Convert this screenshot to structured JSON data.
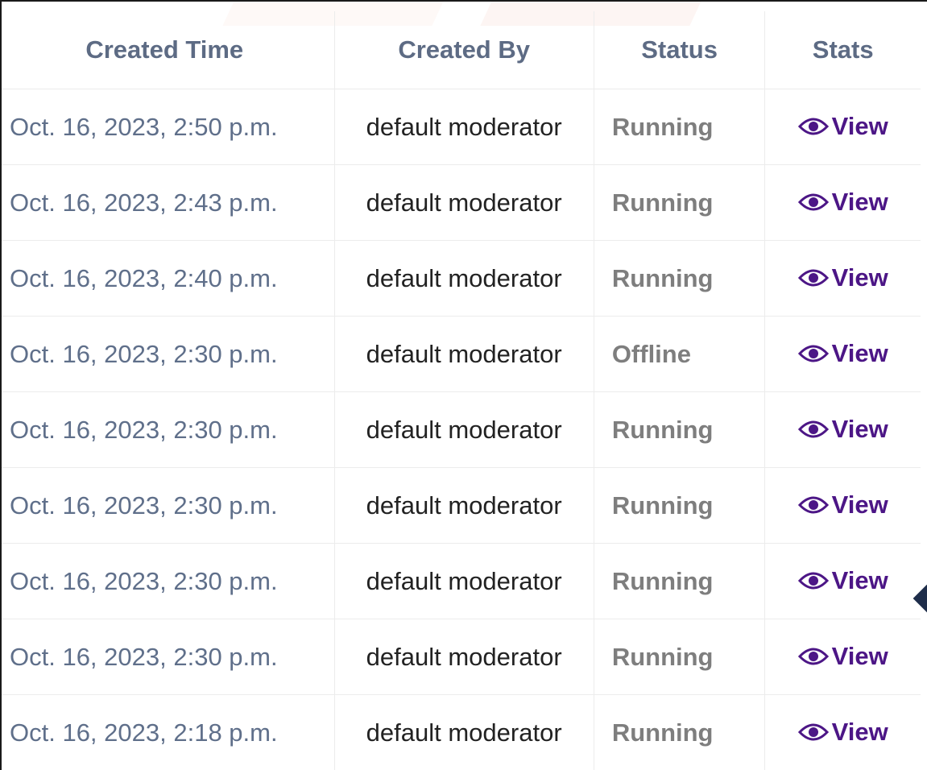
{
  "table": {
    "headers": {
      "created_time": "Created Time",
      "created_by": "Created By",
      "status": "Status",
      "stats": "Stats"
    },
    "rows": [
      {
        "created_time": "Oct. 16, 2023, 2:50 p.m.",
        "created_by": "default moderator",
        "status": "Running",
        "stats": "View"
      },
      {
        "created_time": "Oct. 16, 2023, 2:43 p.m.",
        "created_by": "default moderator",
        "status": "Running",
        "stats": "View"
      },
      {
        "created_time": "Oct. 16, 2023, 2:40 p.m.",
        "created_by": "default moderator",
        "status": "Running",
        "stats": "View"
      },
      {
        "created_time": "Oct. 16, 2023, 2:30 p.m.",
        "created_by": "default moderator",
        "status": "Offline",
        "stats": "View"
      },
      {
        "created_time": "Oct. 16, 2023, 2:30 p.m.",
        "created_by": "default moderator",
        "status": "Running",
        "stats": "View"
      },
      {
        "created_time": "Oct. 16, 2023, 2:30 p.m.",
        "created_by": "default moderator",
        "status": "Running",
        "stats": "View"
      },
      {
        "created_time": "Oct. 16, 2023, 2:30 p.m.",
        "created_by": "default moderator",
        "status": "Running",
        "stats": "View"
      },
      {
        "created_time": "Oct. 16, 2023, 2:30 p.m.",
        "created_by": "default moderator",
        "status": "Running",
        "stats": "View"
      },
      {
        "created_time": "Oct. 16, 2023, 2:18 p.m.",
        "created_by": "default moderator",
        "status": "Running",
        "stats": "View"
      }
    ]
  },
  "icons": {
    "view_icon": "eye-icon"
  },
  "colors": {
    "header_text": "#5d6b84",
    "time_text": "#5f6f8a",
    "status_text": "#7e7e7e",
    "link": "#4c1686"
  }
}
